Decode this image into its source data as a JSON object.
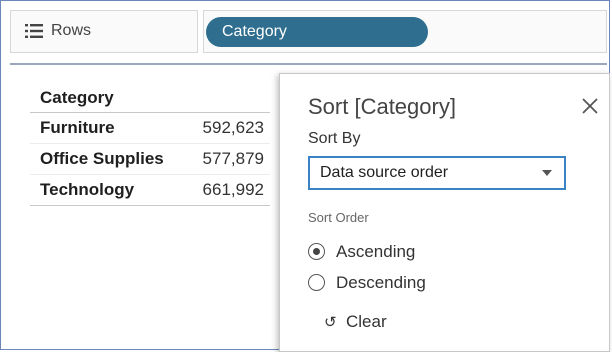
{
  "shelf": {
    "rows_label": "Rows",
    "pill_label": "Category",
    "pill_color": "#2f6e8e"
  },
  "crosstab": {
    "header": "Category",
    "rows": [
      {
        "name": "Furniture",
        "value": "592,623"
      },
      {
        "name": "Office Supplies",
        "value": "577,879"
      },
      {
        "name": "Technology",
        "value": "661,992"
      }
    ]
  },
  "dialog": {
    "title": "Sort [Category]",
    "close_icon": "close-icon",
    "sort_by_label": "Sort By",
    "sort_by_value": "Data source order",
    "sort_order_label": "Sort Order",
    "options": [
      {
        "label": "Ascending",
        "selected": true
      },
      {
        "label": "Descending",
        "selected": false
      }
    ],
    "clear_label": "Clear",
    "accent": "#3b82c4"
  }
}
